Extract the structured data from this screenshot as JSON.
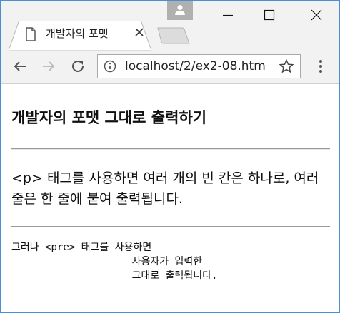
{
  "browser": {
    "tab": {
      "title": "개발자의 포맷"
    },
    "address_bar": {
      "url": "localhost/2/ex2-08.htm"
    },
    "icons": {
      "page": "document-icon",
      "close": "close-icon",
      "back": "back-arrow-icon",
      "forward": "forward-arrow-icon",
      "reload": "reload-icon",
      "info": "info-icon",
      "star": "star-icon",
      "menu": "kebab-menu-icon",
      "profile": "person-icon"
    }
  },
  "page": {
    "heading": "개발자의 포맷 그대로 출력하기",
    "paragraph": "<p> 태그를 사용하면 여러 개의 빈 칸은 하나로, 여러 줄은 한 줄에 붙여 출력됩니다.",
    "pre_text": "그러나 <pre> 태그를 사용하면\n                    사용자가 입력한\n                    그대로 출력됩니다."
  },
  "colors": {
    "chrome_bg": "#f2f2f2",
    "window_border": "#4a8fd6",
    "profile_bg": "#b0b0b0"
  }
}
